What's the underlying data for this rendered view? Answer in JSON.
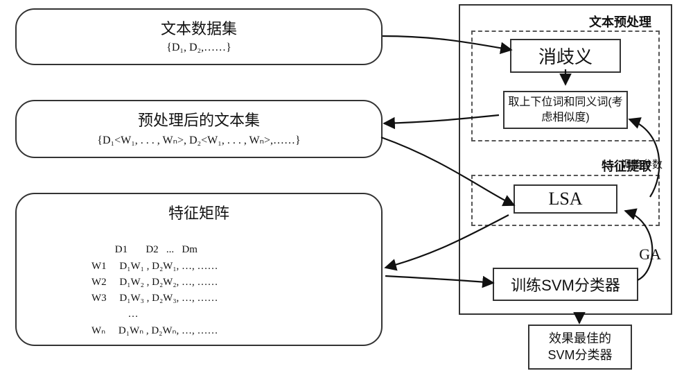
{
  "dataset": {
    "title": "文本数据集",
    "subtitle": "{D₁, D₂,……}"
  },
  "preprocessed": {
    "title": "预处理后的文本集",
    "subtitle": "{D₁<W₁, . . . , Wₙ>, D₂<W₁, . . . , Wₙ>,……}"
  },
  "matrix": {
    "title": "特征矩阵",
    "header": "         D1       D2   ...   Dm",
    "rows": [
      "W1     D₁W₁ , D₂W₁, …, ……",
      "W2     D₁W₂ , D₂W₂, …, ……",
      "W3     D₁W₃ , D₂W₃, …, ……",
      "              …",
      "Wₙ     D₁Wₙ , D₂Wₙ, …, ……"
    ]
  },
  "right": {
    "preprocess_label": "文本预处理",
    "disamb": "消歧义",
    "hypernym": "取上下位词和同义词(考虑相似度)",
    "feature_label": "特征提取",
    "lsa": "LSA",
    "train": "训练SVM分类器",
    "param_label": "调整参数",
    "ga_label": "GA"
  },
  "result": {
    "line1": "效果最佳的",
    "line2": "SVM分类器"
  }
}
